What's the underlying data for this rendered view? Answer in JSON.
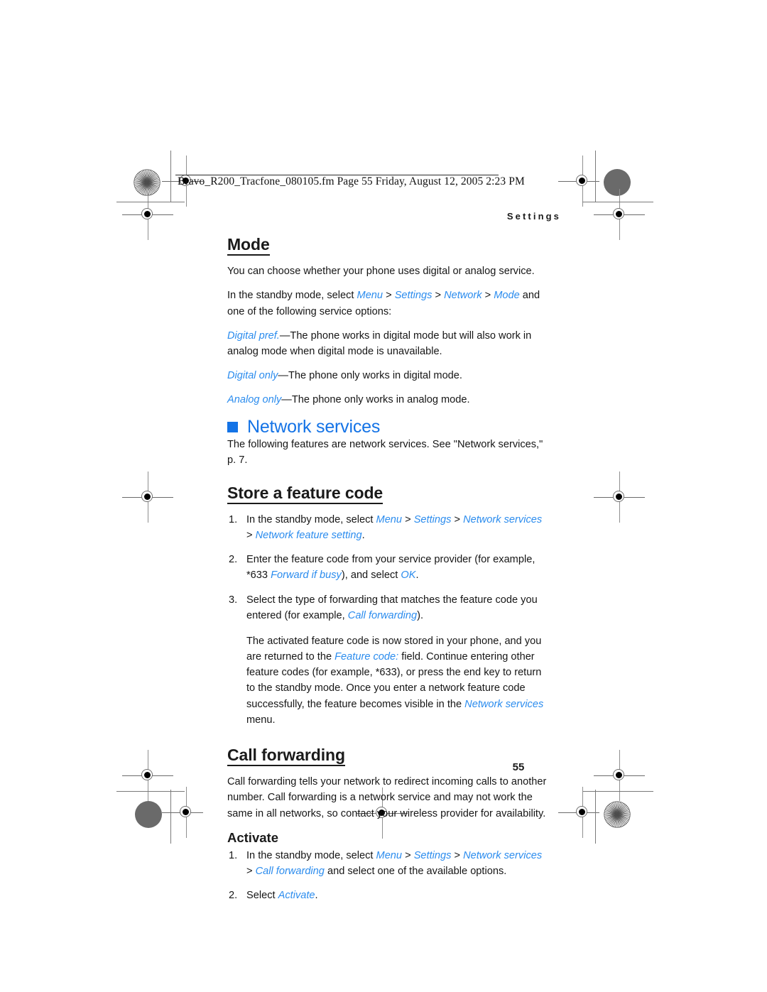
{
  "print_slug": "Bravo_R200_Tracfone_080105.fm  Page 55  Friday, August 12, 2005  2:23 PM",
  "running_header": "Settings",
  "folio": "55",
  "colors": {
    "chapter_blue": "#1473e6",
    "inline_blue": "#2b8cee",
    "body_black": "#161616"
  },
  "sections": {
    "mode": {
      "heading": "Mode",
      "p1": "You can choose whether your phone uses digital or analog service.",
      "p2": {
        "lead": "In the standby mode, select ",
        "ref1": "Menu",
        "sep1": " > ",
        "ref2": "Settings",
        "sep2": " > ",
        "ref3": "Network",
        "sep3": " > ",
        "ref4": "Mode",
        "tail": " and one of the following service options:"
      },
      "opt1": {
        "term": "Digital pref.",
        "desc": "—The phone works in digital mode but will also work in analog mode when digital mode is unavailable."
      },
      "opt2": {
        "term": "Digital only",
        "desc": "—The phone only works in digital mode."
      },
      "opt3": {
        "term": "Analog only",
        "desc": "—The phone only works in analog mode."
      }
    },
    "network_services": {
      "heading": "Network services",
      "intro": "The following features are network services. See \"Network services,\" p. 7.",
      "store_feature_code": {
        "heading": "Store a feature code",
        "step1": {
          "num": "1.",
          "lead": "In the standby mode, select ",
          "ref1": "Menu",
          "sep1": " > ",
          "ref2": "Settings",
          "sep2": " > ",
          "ref3": "Network services",
          "sep3": " > ",
          "ref4": "Network feature setting",
          "tail": "."
        },
        "step2": {
          "num": "2.",
          "lead": "Enter the feature code from your service provider (for example, *633 ",
          "ref1": "Forward if busy",
          "mid": "), and select ",
          "ref2": "OK",
          "tail": "."
        },
        "step3": {
          "num": "3.",
          "lead": "Select the type of forwarding that matches the feature code you entered (for example, ",
          "ref1": "Call forwarding",
          "tail": ")."
        },
        "note": {
          "lead": "The activated feature code is now stored in your phone, and you are returned to the ",
          "ref1": "Feature code:",
          "mid": " field. Continue entering other feature codes (for example, *633), or press the end key to return to the standby mode. Once you enter a network feature code successfully, the feature becomes visible in the ",
          "ref2": "Network services",
          "tail": " menu."
        }
      },
      "call_forwarding": {
        "heading": "Call forwarding",
        "p1": "Call forwarding tells your network to redirect incoming calls to another number. Call forwarding is a network service and may not work the same in all networks, so contact your wireless provider for availability.",
        "activate": {
          "heading": "Activate",
          "step1": {
            "num": "1.",
            "lead": "In the standby mode, select ",
            "ref1": "Menu",
            "sep1": " > ",
            "ref2": "Settings",
            "sep2": " > ",
            "ref3": "Network services",
            "sep3": " > ",
            "ref4": "Call forwarding",
            "tail": " and select one of the available options."
          },
          "step2": {
            "num": "2.",
            "lead": "Select ",
            "ref1": "Activate",
            "tail": "."
          }
        }
      }
    }
  }
}
